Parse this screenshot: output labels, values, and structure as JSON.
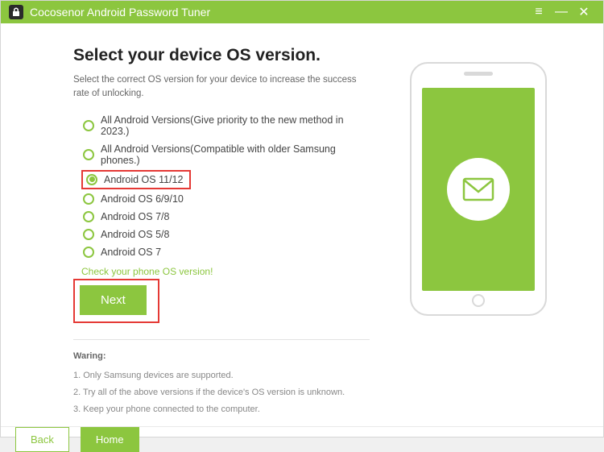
{
  "titlebar": {
    "title": "Cocosenor Android Password Tuner"
  },
  "main": {
    "heading": "Select your device OS version.",
    "subheading": "Select the correct OS version for your device to increase the success rate of unlocking.",
    "options": [
      {
        "label": "All Android Versions(Give priority to the new method in 2023.)",
        "selected": false
      },
      {
        "label": "All Android Versions(Compatible with older Samsung phones.)",
        "selected": false
      },
      {
        "label": "Android OS 11/12",
        "selected": true,
        "highlighted": true
      },
      {
        "label": "Android OS 6/9/10",
        "selected": false
      },
      {
        "label": "Android OS 7/8",
        "selected": false
      },
      {
        "label": "Android OS 5/8",
        "selected": false
      },
      {
        "label": "Android OS 7",
        "selected": false
      }
    ],
    "check_link": "Check your phone OS version!",
    "next_label": "Next",
    "warning": {
      "title": "Waring:",
      "lines": [
        "1. Only Samsung devices are supported.",
        "2. Try all of the above versions if the device's OS version is unknown.",
        "3. Keep your phone connected to the computer."
      ]
    }
  },
  "footer": {
    "back_label": "Back",
    "home_label": "Home"
  }
}
